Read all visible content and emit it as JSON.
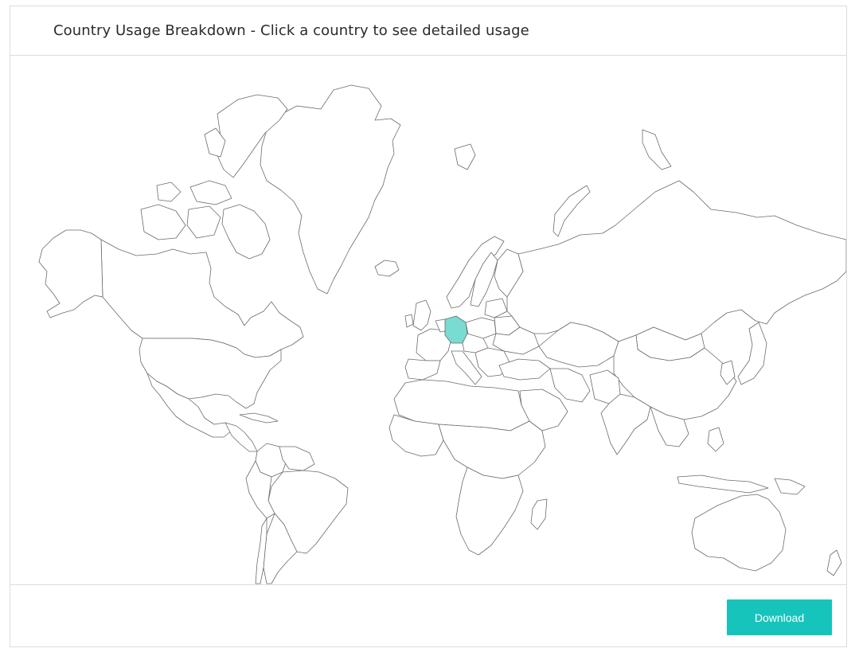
{
  "header": {
    "title": "Country Usage Breakdown - Click a country to see detailed usage"
  },
  "map": {
    "selected_country": "Germany",
    "highlight_color": "#79dbd2",
    "fill_color": "#ffffff",
    "stroke_color": "#6b6b6b"
  },
  "footer": {
    "download_label": "Download",
    "download_color": "#17c4bb"
  }
}
